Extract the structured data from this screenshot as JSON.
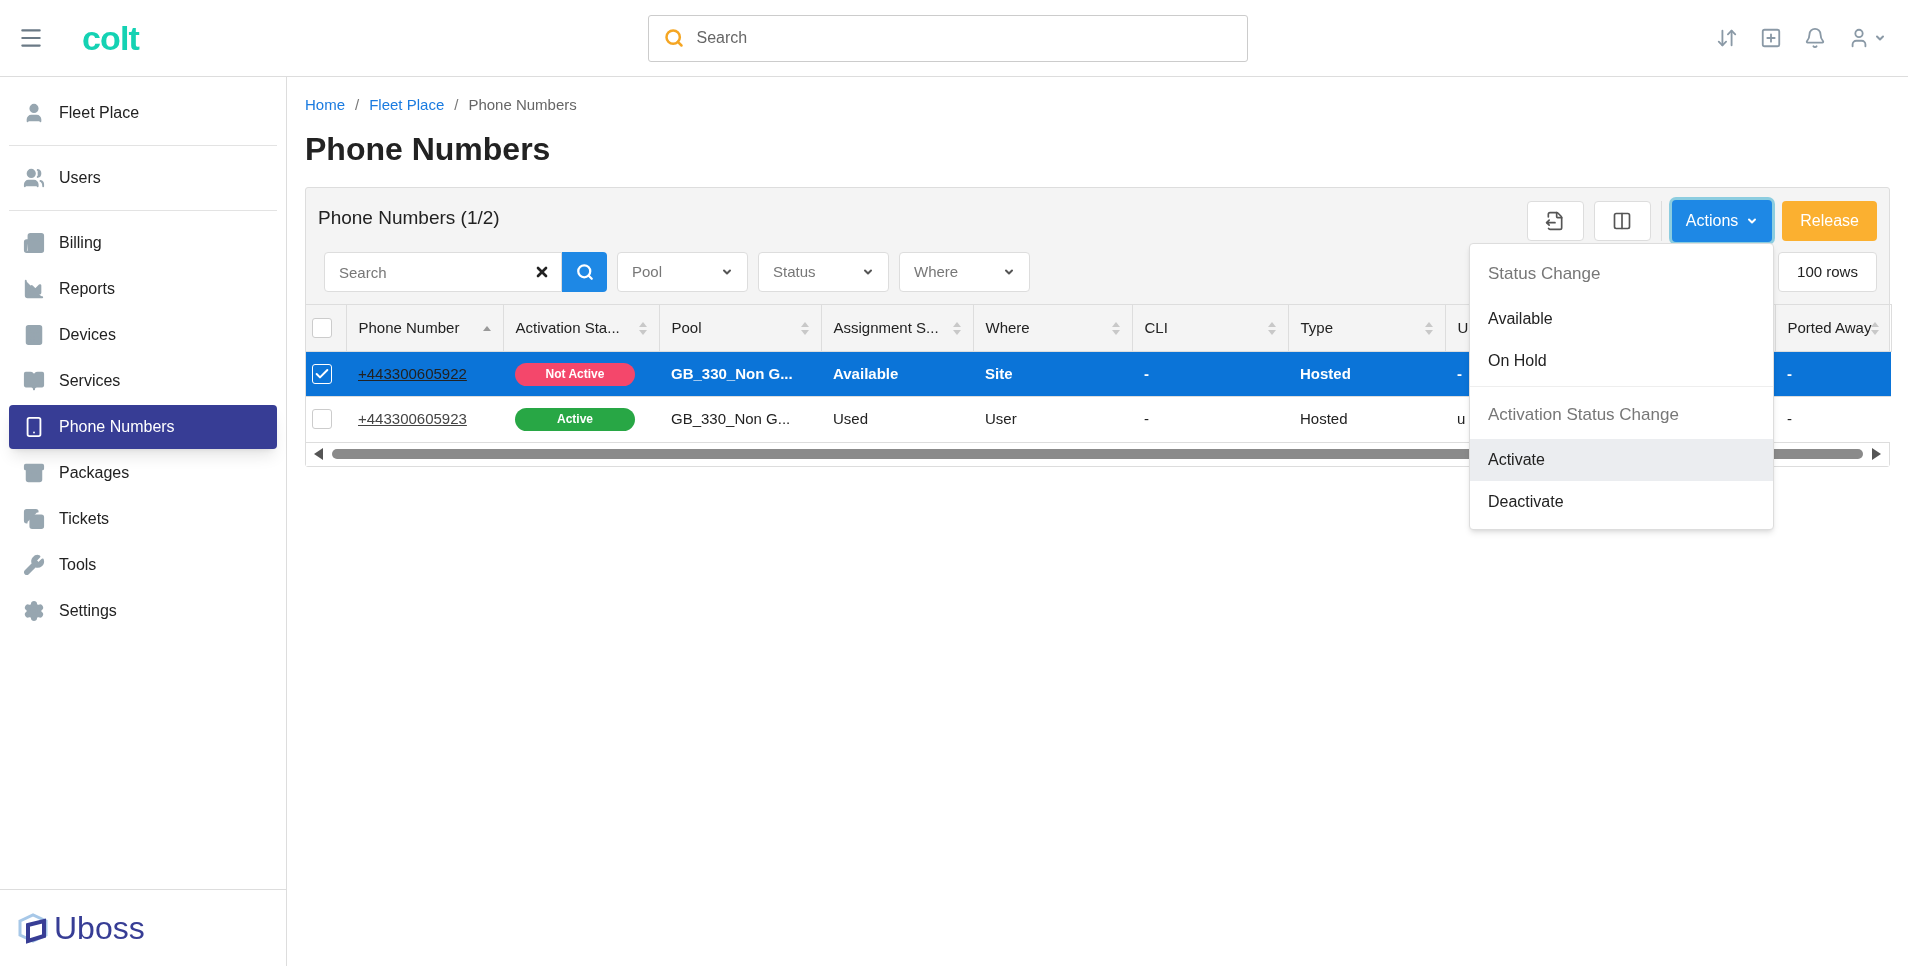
{
  "header": {
    "logo": "colt",
    "search": {
      "placeholder": "Search"
    }
  },
  "sidebar": {
    "groups": [
      {
        "items": [
          {
            "label": "Fleet Place",
            "selected": false
          }
        ]
      },
      {
        "items": [
          {
            "label": "Users",
            "selected": false
          }
        ]
      },
      {
        "items": [
          {
            "label": "Billing",
            "selected": false
          },
          {
            "label": "Reports",
            "selected": false
          },
          {
            "label": "Devices",
            "selected": false
          },
          {
            "label": "Services",
            "selected": false
          },
          {
            "label": "Phone Numbers",
            "selected": true
          },
          {
            "label": "Packages",
            "selected": false
          },
          {
            "label": "Tickets",
            "selected": false
          },
          {
            "label": "Tools",
            "selected": false
          },
          {
            "label": "Settings",
            "selected": false
          }
        ]
      }
    ],
    "footer_logo": "Uboss"
  },
  "breadcrumb": {
    "separator": "/",
    "items": [
      {
        "label": "Home",
        "link": true
      },
      {
        "label": "Fleet Place",
        "link": true
      },
      {
        "label": "Phone Numbers",
        "link": false
      }
    ]
  },
  "page_title": "Phone Numbers",
  "card": {
    "title": "Phone Numbers (1/2)",
    "buttons": [
      {
        "label": "Actions",
        "kind": "actions"
      },
      {
        "label": "Release",
        "kind": "release"
      }
    ],
    "filters": {
      "search": {
        "placeholder": "Search"
      },
      "selects": [
        {
          "placeholder": "Pool"
        },
        {
          "placeholder": "Status"
        },
        {
          "placeholder": "Where"
        }
      ]
    },
    "rows_select": "100 rows",
    "table": {
      "header_checkbox": {
        "checked": false
      },
      "columns": [
        {
          "label": "Phone Number",
          "sorted": true
        },
        {
          "label": "Activation Sta...",
          "sorted": false
        },
        {
          "label": "Pool",
          "sorted": false
        },
        {
          "label": "Assignment S...",
          "sorted": false
        },
        {
          "label": "Where",
          "sorted": false
        },
        {
          "label": "CLI",
          "sorted": false
        },
        {
          "label": "Type",
          "sorted": false
        },
        {
          "label": "U"
        },
        {
          "label": "Ported Away",
          "sorted": false
        }
      ],
      "rows": [
        {
          "selected": true,
          "color": "#f4476b",
          "cells": [
            "+443300605922",
            "Not Active",
            "GB_330_Non G...",
            "Available",
            "Site",
            "-",
            "Hosted",
            "-",
            "-"
          ]
        },
        {
          "selected": false,
          "color": "#28a745",
          "cells": [
            "+443300605923",
            "Active",
            "GB_330_Non G...",
            "Used",
            "User",
            "-",
            "Hosted",
            "u",
            "-"
          ]
        }
      ]
    },
    "actions_menu": {
      "sections": [
        {
          "title": "Status Change",
          "items": [
            {
              "label": "Available",
              "highlighted": false
            },
            {
              "label": "On Hold",
              "highlighted": false
            }
          ]
        },
        {
          "title": "Activation Status Change",
          "items": [
            {
              "label": "Activate",
              "highlighted": true
            },
            {
              "label": "Deactivate",
              "highlighted": false
            }
          ]
        }
      ]
    }
  }
}
